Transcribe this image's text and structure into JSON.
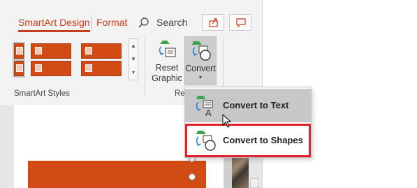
{
  "ribbon": {
    "tabs": [
      {
        "label": "SmartArt Design",
        "active": true
      },
      {
        "label": "Format",
        "active": false
      }
    ],
    "search": {
      "label": "Search",
      "icon": "search-icon"
    },
    "share_icon": "share-icon",
    "comment_icon": "comment-icon",
    "groups": {
      "smartart_styles_label": "SmartArt Styles",
      "reset_label": "Re"
    },
    "buttons": {
      "reset": {
        "line1": "Reset",
        "line2": "Graphic",
        "icon": "reset-graphic-icon"
      },
      "convert": {
        "line1": "Convert",
        "caret": "▾",
        "icon": "convert-icon"
      }
    },
    "gallery_scroll": {
      "up": "▲",
      "down": "▼",
      "more": "▾"
    },
    "accent_color": "#c43e1c",
    "swatch_color": "#d24a14"
  },
  "menu": {
    "items": [
      {
        "label": "Convert to Text",
        "icon": "convert-to-text-icon",
        "highlighted": true
      },
      {
        "label": "Convert to Shapes",
        "icon": "convert-to-shapes-icon",
        "outlined": true
      }
    ],
    "outline_color": "#e4202a"
  }
}
